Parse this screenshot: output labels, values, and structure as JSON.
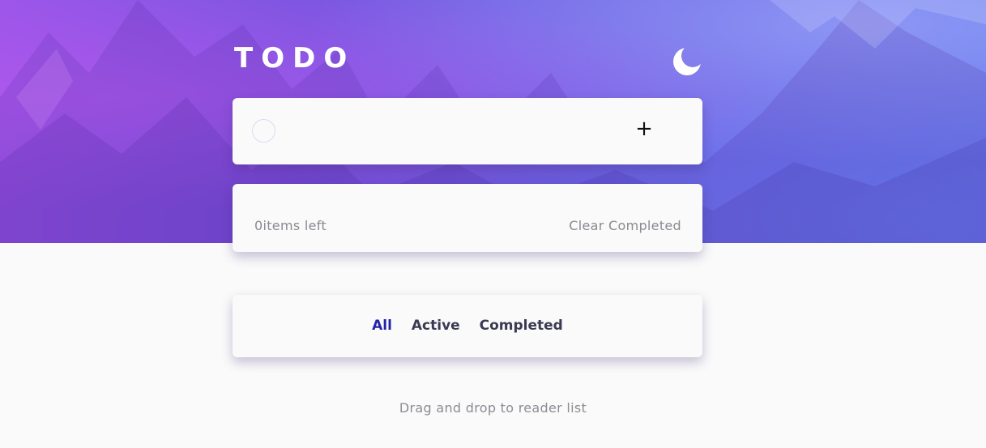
{
  "header": {
    "title": "TODO",
    "theme_icon": "moon-icon"
  },
  "new_todo": {
    "input_value": "",
    "input_placeholder": "",
    "add_icon": "plus-icon",
    "add_label": "+"
  },
  "list": {
    "items": [],
    "items_left": "0items left",
    "clear_label": "Clear Completed"
  },
  "filters": {
    "items": [
      {
        "label": "All",
        "active": true
      },
      {
        "label": "Active",
        "active": false
      },
      {
        "label": "Completed",
        "active": false
      }
    ]
  },
  "footer": {
    "hint": "Drag and drop to reader list"
  },
  "colors": {
    "accent": "#2424a8",
    "hero_start": "#9a55e8",
    "hero_end": "#6677ea",
    "card_bg": "#fafafa"
  }
}
